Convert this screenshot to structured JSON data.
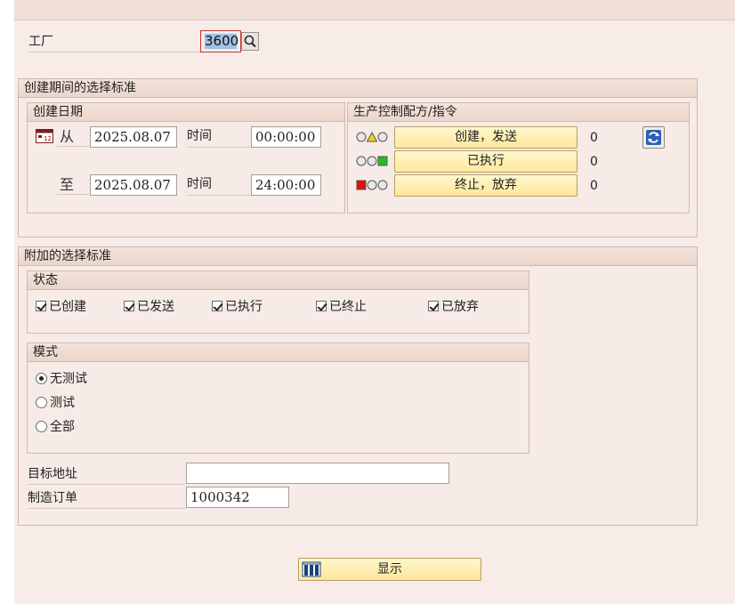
{
  "plant": {
    "label": "工厂",
    "value": "3600"
  },
  "creation_period": {
    "title": "创建期间的选择标准",
    "creation_date": {
      "title": "创建日期",
      "from_label": "从",
      "from_date": "2025.08.07",
      "from_time_label": "时间",
      "from_time": "00:00:00",
      "to_label": "至",
      "to_date": "2025.08.07",
      "to_time_label": "时间",
      "to_time": "24:00:00"
    },
    "production_control": {
      "title": "生产控制配方/指令",
      "rows": [
        {
          "label": "创建，发送",
          "count": "0",
          "light": "yellow"
        },
        {
          "label": "已执行",
          "count": "0",
          "light": "green"
        },
        {
          "label": "终止，放弃",
          "count": "0",
          "light": "red"
        }
      ]
    }
  },
  "additional": {
    "title": "附加的选择标准",
    "status": {
      "title": "状态",
      "items": [
        {
          "label": "已创建",
          "checked": true
        },
        {
          "label": "已发送",
          "checked": true
        },
        {
          "label": "已执行",
          "checked": true
        },
        {
          "label": "已终止",
          "checked": true
        },
        {
          "label": "已放弃",
          "checked": true
        }
      ]
    },
    "mode": {
      "title": "模式",
      "options": [
        {
          "label": "无测试",
          "selected": true
        },
        {
          "label": "测试",
          "selected": false
        },
        {
          "label": "全部",
          "selected": false
        }
      ]
    },
    "target_address": {
      "label": "目标地址",
      "value": ""
    },
    "production_order": {
      "label": "制造订单",
      "value": "1000342"
    }
  },
  "display_button": {
    "label": "显示"
  },
  "colors": {
    "light_yellow": "#f2d20c",
    "light_green": "#1fbf1f",
    "light_red": "#e01010",
    "button_yellow": "#fde79a",
    "background": "#f7ece8"
  }
}
